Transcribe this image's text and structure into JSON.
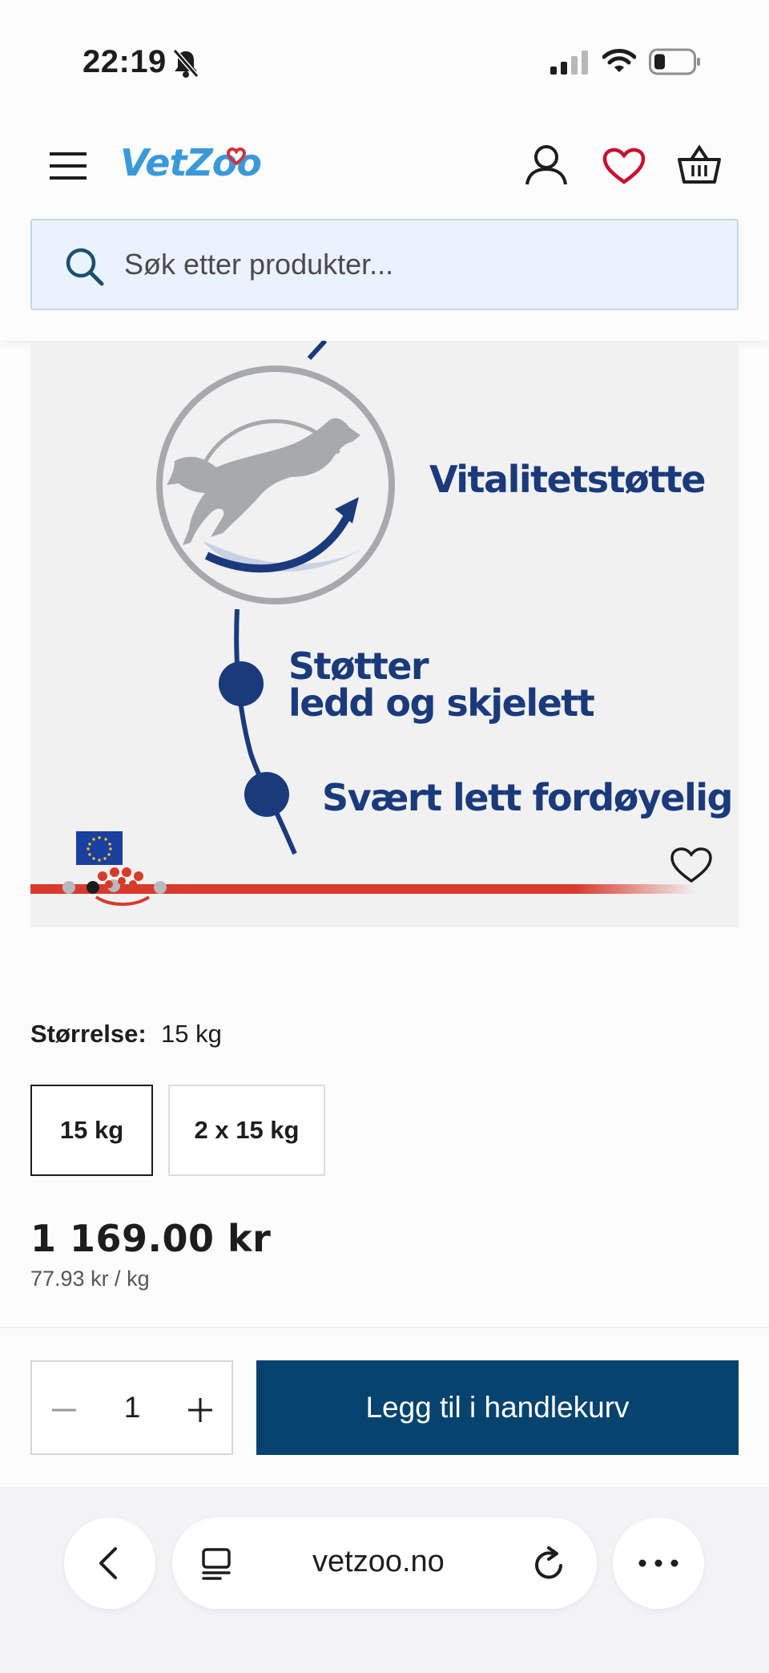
{
  "status_bar": {
    "time": "22:19"
  },
  "header": {
    "logo": "VetZoo",
    "search": {
      "placeholder": "Søk etter produkter..."
    }
  },
  "product_image": {
    "claims": [
      "Vitalitetstøtte",
      "Støtter",
      "ledd og skjelett",
      "Svært lett fordøyelig"
    ]
  },
  "size": {
    "label": "Størrelse:",
    "selected": "15 kg",
    "options": [
      "15 kg",
      "2 x 15 kg"
    ]
  },
  "price": {
    "amount": "1 169.00 kr",
    "unit": "77.93 kr / kg"
  },
  "cart": {
    "quantity": "1",
    "add_label": "Legg til i handlekurv"
  },
  "browser": {
    "url": "vetzoo.no"
  },
  "colors": {
    "brand_blue": "#3a9ad9",
    "cart_button": "#06436f",
    "heart_red": "#c8102e",
    "claim_blue": "#1a3a7c",
    "stripe_red": "#d83a2b"
  }
}
